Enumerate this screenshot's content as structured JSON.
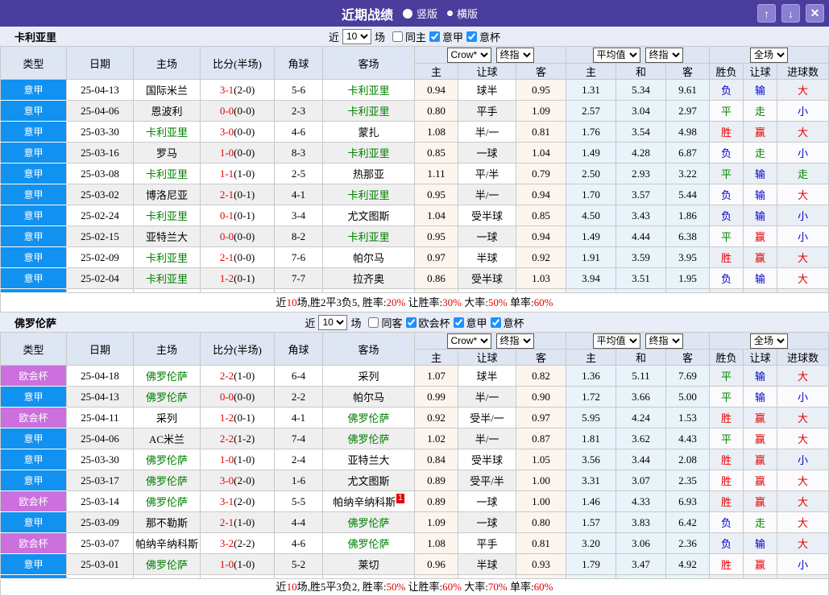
{
  "titlebar": {
    "title": "近期战绩",
    "radio_vertical": "竖版",
    "radio_horizontal": "横版",
    "buttons": {
      "up": "↑",
      "down": "↓",
      "close": "✕"
    }
  },
  "colors": {
    "titlebar_bg": "#4a3d9b",
    "league_seriea": "#1191f0",
    "league_uecl": "#cb70dd",
    "team_green": "#008000",
    "score_red": "#e60000",
    "win_red": "#e60000",
    "draw_green": "#008800",
    "lose_blue": "#0000cc",
    "checkbox_blue": "#1e90ff"
  },
  "columns": {
    "type": "类型",
    "date": "日期",
    "home": "主场",
    "score": "比分(半场)",
    "corner": "角球",
    "away": "客场",
    "sub": [
      "主",
      "让球",
      "客",
      "主",
      "和",
      "客",
      "胜负",
      "让球",
      "进球数"
    ],
    "selects": {
      "crow": "Crow*",
      "final1": "终指",
      "avg": "平均值",
      "final2": "终指",
      "full": "全场"
    }
  },
  "sections": [
    {
      "team": "卡利亚里",
      "controls": {
        "near": "近",
        "count": "10",
        "games": "场",
        "same": "同主",
        "same_checked": false,
        "leagues": [
          {
            "label": "意甲",
            "checked": true
          },
          {
            "label": "意杯",
            "checked": true
          }
        ]
      },
      "rows": [
        {
          "league": "意甲",
          "lc": "b",
          "date": "25-04-13",
          "home": "国际米兰",
          "hg": false,
          "score": "3-1",
          "half": "(2-0)",
          "corner": "5-6",
          "away": "卡利亚里",
          "ag": true,
          "sup": "",
          "odds": [
            "0.94",
            "球半",
            "0.95"
          ],
          "avg": [
            "1.31",
            "5.34",
            "9.61"
          ],
          "res": [
            [
              "负",
              "b"
            ],
            [
              "输",
              "b"
            ],
            [
              "大",
              "r"
            ]
          ]
        },
        {
          "league": "意甲",
          "lc": "b",
          "date": "25-04-06",
          "home": "恩波利",
          "hg": false,
          "score": "0-0",
          "half": "(0-0)",
          "corner": "2-3",
          "away": "卡利亚里",
          "ag": true,
          "sup": "",
          "odds": [
            "0.80",
            "平手",
            "1.09"
          ],
          "avg": [
            "2.57",
            "3.04",
            "2.97"
          ],
          "res": [
            [
              "平",
              "g"
            ],
            [
              "走",
              "g"
            ],
            [
              "小",
              "b"
            ]
          ]
        },
        {
          "league": "意甲",
          "lc": "b",
          "date": "25-03-30",
          "home": "卡利亚里",
          "hg": true,
          "score": "3-0",
          "half": "(0-0)",
          "corner": "4-6",
          "away": "蒙扎",
          "ag": false,
          "sup": "",
          "odds": [
            "1.08",
            "半/一",
            "0.81"
          ],
          "avg": [
            "1.76",
            "3.54",
            "4.98"
          ],
          "res": [
            [
              "胜",
              "r"
            ],
            [
              "赢",
              "r"
            ],
            [
              "大",
              "r"
            ]
          ]
        },
        {
          "league": "意甲",
          "lc": "b",
          "date": "25-03-16",
          "home": "罗马",
          "hg": false,
          "score": "1-0",
          "half": "(0-0)",
          "corner": "8-3",
          "away": "卡利亚里",
          "ag": true,
          "sup": "",
          "odds": [
            "0.85",
            "一球",
            "1.04"
          ],
          "avg": [
            "1.49",
            "4.28",
            "6.87"
          ],
          "res": [
            [
              "负",
              "b"
            ],
            [
              "走",
              "g"
            ],
            [
              "小",
              "b"
            ]
          ]
        },
        {
          "league": "意甲",
          "lc": "b",
          "date": "25-03-08",
          "home": "卡利亚里",
          "hg": true,
          "score": "1-1",
          "half": "(1-0)",
          "corner": "2-5",
          "away": "热那亚",
          "ag": false,
          "sup": "",
          "odds": [
            "1.11",
            "平/半",
            "0.79"
          ],
          "avg": [
            "2.50",
            "2.93",
            "3.22"
          ],
          "res": [
            [
              "平",
              "g"
            ],
            [
              "输",
              "b"
            ],
            [
              "走",
              "g"
            ]
          ]
        },
        {
          "league": "意甲",
          "lc": "b",
          "date": "25-03-02",
          "home": "博洛尼亚",
          "hg": false,
          "score": "2-1",
          "half": "(0-1)",
          "corner": "4-1",
          "away": "卡利亚里",
          "ag": true,
          "sup": "",
          "odds": [
            "0.95",
            "半/一",
            "0.94"
          ],
          "avg": [
            "1.70",
            "3.57",
            "5.44"
          ],
          "res": [
            [
              "负",
              "b"
            ],
            [
              "输",
              "b"
            ],
            [
              "大",
              "r"
            ]
          ]
        },
        {
          "league": "意甲",
          "lc": "b",
          "date": "25-02-24",
          "home": "卡利亚里",
          "hg": true,
          "score": "0-1",
          "half": "(0-1)",
          "corner": "3-4",
          "away": "尤文图斯",
          "ag": false,
          "sup": "",
          "odds": [
            "1.04",
            "受半球",
            "0.85"
          ],
          "avg": [
            "4.50",
            "3.43",
            "1.86"
          ],
          "res": [
            [
              "负",
              "b"
            ],
            [
              "输",
              "b"
            ],
            [
              "小",
              "b"
            ]
          ]
        },
        {
          "league": "意甲",
          "lc": "b",
          "date": "25-02-15",
          "home": "亚特兰大",
          "hg": false,
          "score": "0-0",
          "half": "(0-0)",
          "corner": "8-2",
          "away": "卡利亚里",
          "ag": true,
          "sup": "",
          "odds": [
            "0.95",
            "一球",
            "0.94"
          ],
          "avg": [
            "1.49",
            "4.44",
            "6.38"
          ],
          "res": [
            [
              "平",
              "g"
            ],
            [
              "赢",
              "r"
            ],
            [
              "小",
              "b"
            ]
          ]
        },
        {
          "league": "意甲",
          "lc": "b",
          "date": "25-02-09",
          "home": "卡利亚里",
          "hg": true,
          "score": "2-1",
          "half": "(0-0)",
          "corner": "7-6",
          "away": "帕尔马",
          "ag": false,
          "sup": "",
          "odds": [
            "0.97",
            "半球",
            "0.92"
          ],
          "avg": [
            "1.91",
            "3.59",
            "3.95"
          ],
          "res": [
            [
              "胜",
              "r"
            ],
            [
              "赢",
              "r"
            ],
            [
              "大",
              "r"
            ]
          ]
        },
        {
          "league": "意甲",
          "lc": "b",
          "date": "25-02-04",
          "home": "卡利亚里",
          "hg": true,
          "score": "1-2",
          "half": "(0-1)",
          "corner": "7-7",
          "away": "拉齐奥",
          "ag": false,
          "sup": "",
          "odds": [
            "0.86",
            "受半球",
            "1.03"
          ],
          "avg": [
            "3.94",
            "3.51",
            "1.95"
          ],
          "res": [
            [
              "负",
              "b"
            ],
            [
              "输",
              "b"
            ],
            [
              "大",
              "r"
            ]
          ]
        }
      ],
      "summary": [
        {
          "t": "近",
          "r": false
        },
        {
          "t": "10",
          "r": true
        },
        {
          "t": "场,胜2平3负5, 胜率:",
          "r": false
        },
        {
          "t": "20%",
          "r": true
        },
        {
          "t": " 让胜率:",
          "r": false
        },
        {
          "t": "30%",
          "r": true
        },
        {
          "t": " 大率:",
          "r": false
        },
        {
          "t": "50%",
          "r": true
        },
        {
          "t": " 单率:",
          "r": false
        },
        {
          "t": "60%",
          "r": true
        }
      ]
    },
    {
      "team": "佛罗伦萨",
      "controls": {
        "near": "近",
        "count": "10",
        "games": "场",
        "same": "同客",
        "same_checked": false,
        "leagues": [
          {
            "label": "欧会杯",
            "checked": true
          },
          {
            "label": "意甲",
            "checked": true
          },
          {
            "label": "意杯",
            "checked": true
          }
        ]
      },
      "rows": [
        {
          "league": "欧会杯",
          "lc": "p",
          "date": "25-04-18",
          "home": "佛罗伦萨",
          "hg": true,
          "score": "2-2",
          "half": "(1-0)",
          "corner": "6-4",
          "away": "采列",
          "ag": false,
          "sup": "",
          "odds": [
            "1.07",
            "球半",
            "0.82"
          ],
          "avg": [
            "1.36",
            "5.11",
            "7.69"
          ],
          "res": [
            [
              "平",
              "g"
            ],
            [
              "输",
              "b"
            ],
            [
              "大",
              "r"
            ]
          ]
        },
        {
          "league": "意甲",
          "lc": "b",
          "date": "25-04-13",
          "home": "佛罗伦萨",
          "hg": true,
          "score": "0-0",
          "half": "(0-0)",
          "corner": "2-2",
          "away": "帕尔马",
          "ag": false,
          "sup": "",
          "odds": [
            "0.99",
            "半/一",
            "0.90"
          ],
          "avg": [
            "1.72",
            "3.66",
            "5.00"
          ],
          "res": [
            [
              "平",
              "g"
            ],
            [
              "输",
              "b"
            ],
            [
              "小",
              "b"
            ]
          ]
        },
        {
          "league": "欧会杯",
          "lc": "p",
          "date": "25-04-11",
          "home": "采列",
          "hg": false,
          "score": "1-2",
          "half": "(0-1)",
          "corner": "4-1",
          "away": "佛罗伦萨",
          "ag": true,
          "sup": "",
          "odds": [
            "0.92",
            "受半/一",
            "0.97"
          ],
          "avg": [
            "5.95",
            "4.24",
            "1.53"
          ],
          "res": [
            [
              "胜",
              "r"
            ],
            [
              "赢",
              "r"
            ],
            [
              "大",
              "r"
            ]
          ]
        },
        {
          "league": "意甲",
          "lc": "b",
          "date": "25-04-06",
          "home": "AC米兰",
          "hg": false,
          "score": "2-2",
          "half": "(1-2)",
          "corner": "7-4",
          "away": "佛罗伦萨",
          "ag": true,
          "sup": "",
          "odds": [
            "1.02",
            "半/一",
            "0.87"
          ],
          "avg": [
            "1.81",
            "3.62",
            "4.43"
          ],
          "res": [
            [
              "平",
              "g"
            ],
            [
              "赢",
              "r"
            ],
            [
              "大",
              "r"
            ]
          ]
        },
        {
          "league": "意甲",
          "lc": "b",
          "date": "25-03-30",
          "home": "佛罗伦萨",
          "hg": true,
          "score": "1-0",
          "half": "(1-0)",
          "corner": "2-4",
          "away": "亚特兰大",
          "ag": false,
          "sup": "",
          "odds": [
            "0.84",
            "受半球",
            "1.05"
          ],
          "avg": [
            "3.56",
            "3.44",
            "2.08"
          ],
          "res": [
            [
              "胜",
              "r"
            ],
            [
              "赢",
              "r"
            ],
            [
              "小",
              "b"
            ]
          ]
        },
        {
          "league": "意甲",
          "lc": "b",
          "date": "25-03-17",
          "home": "佛罗伦萨",
          "hg": true,
          "score": "3-0",
          "half": "(2-0)",
          "corner": "1-6",
          "away": "尤文图斯",
          "ag": false,
          "sup": "",
          "odds": [
            "0.89",
            "受平/半",
            "1.00"
          ],
          "avg": [
            "3.31",
            "3.07",
            "2.35"
          ],
          "res": [
            [
              "胜",
              "r"
            ],
            [
              "赢",
              "r"
            ],
            [
              "大",
              "r"
            ]
          ]
        },
        {
          "league": "欧会杯",
          "lc": "p",
          "date": "25-03-14",
          "home": "佛罗伦萨",
          "hg": true,
          "score": "3-1",
          "half": "(2-0)",
          "corner": "5-5",
          "away": "帕纳辛纳科斯",
          "ag": false,
          "sup": "1",
          "odds": [
            "0.89",
            "一球",
            "1.00"
          ],
          "avg": [
            "1.46",
            "4.33",
            "6.93"
          ],
          "res": [
            [
              "胜",
              "r"
            ],
            [
              "赢",
              "r"
            ],
            [
              "大",
              "r"
            ]
          ]
        },
        {
          "league": "意甲",
          "lc": "b",
          "date": "25-03-09",
          "home": "那不勒斯",
          "hg": false,
          "score": "2-1",
          "half": "(1-0)",
          "corner": "4-4",
          "away": "佛罗伦萨",
          "ag": true,
          "sup": "",
          "odds": [
            "1.09",
            "一球",
            "0.80"
          ],
          "avg": [
            "1.57",
            "3.83",
            "6.42"
          ],
          "res": [
            [
              "负",
              "b"
            ],
            [
              "走",
              "g"
            ],
            [
              "大",
              "r"
            ]
          ]
        },
        {
          "league": "欧会杯",
          "lc": "p",
          "date": "25-03-07",
          "home": "帕纳辛纳科斯",
          "hg": false,
          "score": "3-2",
          "half": "(2-2)",
          "corner": "4-6",
          "away": "佛罗伦萨",
          "ag": true,
          "sup": "",
          "odds": [
            "1.08",
            "平手",
            "0.81"
          ],
          "avg": [
            "3.20",
            "3.06",
            "2.36"
          ],
          "res": [
            [
              "负",
              "b"
            ],
            [
              "输",
              "b"
            ],
            [
              "大",
              "r"
            ]
          ]
        },
        {
          "league": "意甲",
          "lc": "b",
          "date": "25-03-01",
          "home": "佛罗伦萨",
          "hg": true,
          "score": "1-0",
          "half": "(1-0)",
          "corner": "5-2",
          "away": "莱切",
          "ag": false,
          "sup": "",
          "odds": [
            "0.96",
            "半球",
            "0.93"
          ],
          "avg": [
            "1.79",
            "3.47",
            "4.92"
          ],
          "res": [
            [
              "胜",
              "r"
            ],
            [
              "赢",
              "r"
            ],
            [
              "小",
              "b"
            ]
          ]
        }
      ],
      "summary": [
        {
          "t": "近",
          "r": false
        },
        {
          "t": "10",
          "r": true
        },
        {
          "t": "场,胜5平3负2, 胜率:",
          "r": false
        },
        {
          "t": "50%",
          "r": true
        },
        {
          "t": " 让胜率:",
          "r": false
        },
        {
          "t": "60%",
          "r": true
        },
        {
          "t": " 大率:",
          "r": false
        },
        {
          "t": "70%",
          "r": true
        },
        {
          "t": " 单率:",
          "r": false
        },
        {
          "t": "60%",
          "r": true
        }
      ]
    }
  ]
}
